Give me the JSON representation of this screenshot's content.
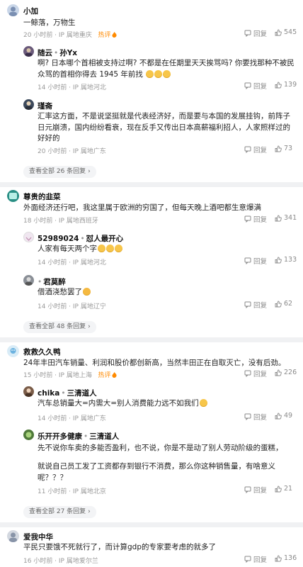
{
  "threads": [
    {
      "user": "小加",
      "text": "一鲸落，万物生",
      "meta": "20 小时前 · IP 属地重庆",
      "hot": "热评",
      "reply_label": "回复",
      "likes": "545",
      "replies": [
        {
          "user": "随云",
          "reply_to": "孙Yx",
          "text": "啊? 日本哪个首相被支持过啊? 不都是在任期里天天挨骂吗? 你要找那种不被民众骂的首相你得去 1945 年前找",
          "meta": "14 小时前 · IP 属地河北",
          "reply_label": "回复",
          "likes": "139"
        },
        {
          "user": "瑾斋",
          "text": "汇率这方面，不是说坚挺就是代表经济好，而是要与本国的发展挂钩，前阵子日元崩溃，国内纷纷看衰，现在反手又传出日本高薪福利招人，人家照样过的好好的",
          "meta": "20 小时前 · IP 属地广东",
          "reply_label": "回复",
          "likes": "73"
        }
      ],
      "more": "查看全部 26 条回复"
    },
    {
      "user": "尊贵的韭菜",
      "text": "外面经济还行吧，我这里属于欧洲的穷国了，但每天晚上酒吧都生意爆满",
      "meta": "18 小时前 · IP 属地西班牙",
      "reply_label": "回复",
      "likes": "341",
      "replies": [
        {
          "user": "52989024",
          "reply_to": "怼人最开心",
          "text": "人家有每天两个字",
          "meta": "14 小时前 · IP 属地河北",
          "reply_label": "回复",
          "likes": "133"
        },
        {
          "user": "君莫醉",
          "text": "借酒浇愁罢了",
          "meta": "14 小时前 · IP 属地辽宁",
          "reply_label": "回复",
          "likes": "62"
        }
      ],
      "more": "查看全部 48 条回复"
    },
    {
      "user": "救救久久鸭",
      "text": "24年丰田汽车销量、利润和股价都创新高，当然丰田正在自取灭亡，没有后劲。",
      "meta": "15 小时前 · IP 属地上海",
      "hot": "热评",
      "reply_label": "回复",
      "likes": "226",
      "replies": [
        {
          "user": "chika",
          "reply_to": "三清道人",
          "text": "汽车总销量大=内需大=别人消费能力远不如我们",
          "meta": "14 小时前 · IP 属地广东",
          "reply_label": "回复",
          "likes": "49"
        },
        {
          "user": "乐开开多健康",
          "reply_to": "三清道人",
          "text": "先不说你车卖的多能否盈利，也不说，你是不是动了别人劳动阶级的蛋糕，",
          "text2": "就说自己员工发了工资都存到银行不消费，那么你这种销售量，有啥意义呢？？？",
          "meta": "11 小时前 · IP 属地北京",
          "reply_label": "回复",
          "likes": "21"
        }
      ],
      "more": "查看全部 27 条回复"
    },
    {
      "user": "爱我中华",
      "text": "平民只要饿不死就行了，而计算gdp的专家要考虑的就多了",
      "meta": "16 小时前 · IP 属地爱尔兰",
      "reply_label": "回复",
      "likes": "136"
    }
  ]
}
